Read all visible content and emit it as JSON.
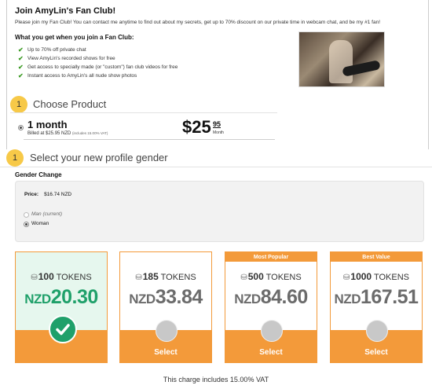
{
  "fan_club": {
    "title": "Join AmyLin's Fan Club!",
    "intro": "Please join my Fan Club! You can contact me anytime to find out about my secrets, get up to 70% discount on our private time in webcam chat, and be my #1 fan!",
    "benefits_heading": "What you get when you join a Fan Club:",
    "benefits": [
      "Up to 70% off private chat",
      "View AmyLin's recorded shows for free",
      "Get access to specially made (or \"custom\") fan club videos for free",
      "Instant access to AmyLin's all nude show photos"
    ]
  },
  "choose_product": {
    "step": "1",
    "title": "Choose Product",
    "option_label": "1 month",
    "billed": "Billed at $25.95 NZD",
    "vat_note": "(includes 15.00% VAT)",
    "price_main": "$25",
    "price_cents": "95",
    "price_period": "Month"
  },
  "gender": {
    "step": "1",
    "title": "Select your new profile gender",
    "section_label": "Gender Change",
    "price_label": "Price:",
    "price_value": "$16.74 NZD",
    "options": [
      {
        "label": "Man (current)",
        "selected": false
      },
      {
        "label": "Woman",
        "selected": true
      }
    ]
  },
  "token_packages": [
    {
      "tokens": "100",
      "tokens_label": "TOKENS",
      "currency": "NZD",
      "amount": "20.30",
      "banner": "",
      "selected": true,
      "button": ""
    },
    {
      "tokens": "185",
      "tokens_label": "TOKENS",
      "currency": "NZD",
      "amount": "33.84",
      "banner": "",
      "selected": false,
      "button": "Select"
    },
    {
      "tokens": "500",
      "tokens_label": "TOKENS",
      "currency": "NZD",
      "amount": "84.60",
      "banner": "Most Popular",
      "selected": false,
      "button": "Select"
    },
    {
      "tokens": "1000",
      "tokens_label": "TOKENS",
      "currency": "NZD",
      "amount": "167.51",
      "banner": "Best Value",
      "selected": false,
      "button": "Select"
    }
  ],
  "footer_note": "This charge includes 15.00% VAT",
  "colors": {
    "accent": "#f39a3a",
    "selected": "#1fa06a",
    "selected_bg": "#e6f7ee",
    "step_badge": "#f7c948"
  },
  "icons": {
    "benefit": "check-icon",
    "token": "coin-icon",
    "selected": "checkmark-icon"
  }
}
